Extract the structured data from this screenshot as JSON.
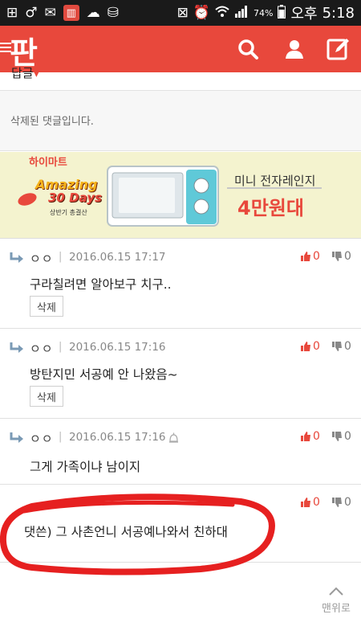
{
  "status_bar": {
    "battery": "74%",
    "ampm": "오후",
    "time": "5:18",
    "icons": [
      "add-box-icon",
      "female-icon",
      "mail-icon",
      "app-icon",
      "cloud-icon",
      "storage-icon",
      "vibrate-icon",
      "alarm-icon",
      "wifi-icon",
      "signal-icon",
      "battery-icon"
    ]
  },
  "app_bar": {
    "logo": "판",
    "color": "#e8483c",
    "icons": [
      "menu-icon",
      "search-icon",
      "user-icon",
      "write-icon"
    ]
  },
  "header_cropped": {
    "label": "답글",
    "arrow": "▾"
  },
  "deleted_comment": {
    "text": "삭제된 댓글입니다."
  },
  "ad": {
    "brand": "하이마트",
    "promo": "Amazing",
    "promo_days": "30 Days",
    "promo_sub": "상반기 총결산",
    "product_line": "미니 전자레인지",
    "price_line": "4만원대"
  },
  "comments": [
    {
      "author": "ㅇㅇ",
      "date": "2016.06.15 17:17",
      "text": "구라칠려면 알아보구 치구..",
      "likes": "0",
      "dislikes": "0",
      "delete_label": "삭제"
    },
    {
      "author": "ㅇㅇ",
      "date": "2016.06.15 17:16",
      "text": "방탄지민 서공예 안 나왔음~",
      "likes": "0",
      "dislikes": "0",
      "delete_label": "삭제"
    },
    {
      "author": "ㅇㅇ",
      "date": "2016.06.15 17:16",
      "text": "그게 가족이냐 남이지",
      "likes": "0",
      "dislikes": "0"
    },
    {
      "text": "댓쓴) 그 사촌언니 서공예나와서 친하대",
      "likes": "0",
      "dislikes": "0"
    }
  ],
  "to_top": {
    "label": "맨위로"
  }
}
